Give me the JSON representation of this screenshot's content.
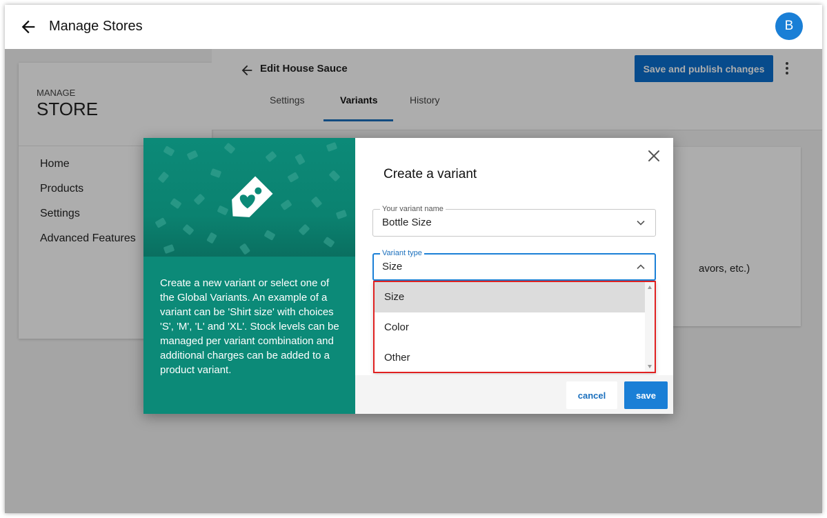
{
  "header": {
    "title": "Manage Stores",
    "avatar_initial": "B",
    "back_icon": "arrow-left-icon"
  },
  "sidebar": {
    "eyebrow": "MANAGE",
    "title": "STORE",
    "items": [
      {
        "label": "Home"
      },
      {
        "label": "Products"
      },
      {
        "label": "Settings"
      },
      {
        "label": "Advanced Features"
      }
    ]
  },
  "editor": {
    "title": "Edit House Sauce",
    "publish_label": "Save and publish changes",
    "tabs": [
      {
        "label": "Settings",
        "active": false
      },
      {
        "label": "Variants",
        "active": true
      },
      {
        "label": "History",
        "active": false
      }
    ],
    "partial_text": "avors, etc.)"
  },
  "modal": {
    "title": "Create a variant",
    "hero_icon": "tag-heart-icon",
    "description": "Create a new variant or select one of the Global Variants. An example of a variant can be 'Shirt size' with choices 'S', 'M', 'L' and 'XL'. Stock levels can be managed per variant combination and additional charges can be added to a product variant.",
    "name_field": {
      "label": "Your variant name",
      "value": "Bottle Size"
    },
    "type_field": {
      "label": "Variant type",
      "value": "Size"
    },
    "type_options": [
      {
        "label": "Size",
        "selected": true
      },
      {
        "label": "Color",
        "selected": false
      },
      {
        "label": "Other",
        "selected": false
      }
    ],
    "cancel_label": "cancel",
    "save_label": "save"
  },
  "colors": {
    "accent": "#1a7fd6",
    "publish": "#0b6fcf",
    "teal": "#0c8a78",
    "highlight": "#e02020"
  }
}
